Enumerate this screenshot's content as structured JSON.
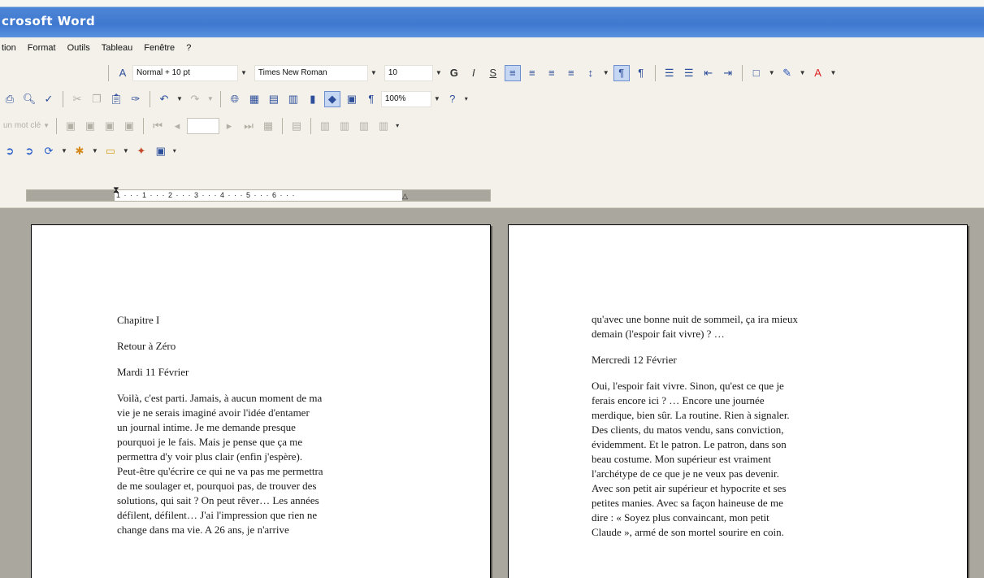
{
  "window": {
    "title": "crosoft Word"
  },
  "menu": [
    "tion",
    "Format",
    "Outils",
    "Tableau",
    "Fenêtre",
    "?"
  ],
  "formatting": {
    "style": "Normal + 10 pt",
    "font": "Times New Roman",
    "size": "10",
    "bold_label": "G",
    "italic_label": "I",
    "underline_label": "S"
  },
  "standard": {
    "zoom": "100%"
  },
  "review": {
    "label": "un mot clé"
  },
  "ruler": {
    "marks": "1 · · · 1 · · · 2 · · · 3 · · · 4 · · · 5 · · · 6 · · ·"
  },
  "pages": {
    "left": {
      "chapter": "Chapitre I",
      "heading": "Retour à Zéro",
      "date": "Mardi 11 Février",
      "body": [
        "Voilà, c'est parti. Jamais, à aucun moment de ma",
        "vie je ne serais imaginé avoir l'idée d'entamer",
        "un journal intime. Je me demande presque",
        "pourquoi je le fais. Mais je pense que ça me",
        "permettra d'y voir plus clair (enfin j'espère).",
        "Peut-être qu'écrire ce qui ne va pas me permettra",
        "de me soulager et, pourquoi pas, de trouver des",
        "solutions, qui sait ? On peut rêver… Les années",
        "défilent, défilent… J'ai l'impression que rien ne",
        "change dans ma vie. A 26 ans, je n'arrive"
      ]
    },
    "right": {
      "cont": [
        "qu'avec une bonne nuit de sommeil, ça ira mieux",
        "demain (l'espoir fait vivre) ? …"
      ],
      "date": "Mercredi 12 Février",
      "body": [
        "Oui, l'espoir fait vivre. Sinon, qu'est ce que je",
        "ferais encore ici ? … Encore une journée",
        "merdique, bien sûr. La routine. Rien à signaler.",
        "Des clients, du matos vendu, sans conviction,",
        "évidemment. Et le patron. Le patron, dans son",
        "beau costume. Mon supérieur est vraiment",
        "l'archétype de ce que je ne veux pas devenir.",
        "Avec son petit air supérieur et hypocrite et ses",
        "petites manies. Avec sa façon haineuse de me",
        "dire : « Soyez plus convaincant, mon petit",
        "Claude », armé de son mortel sourire en coin."
      ]
    }
  }
}
